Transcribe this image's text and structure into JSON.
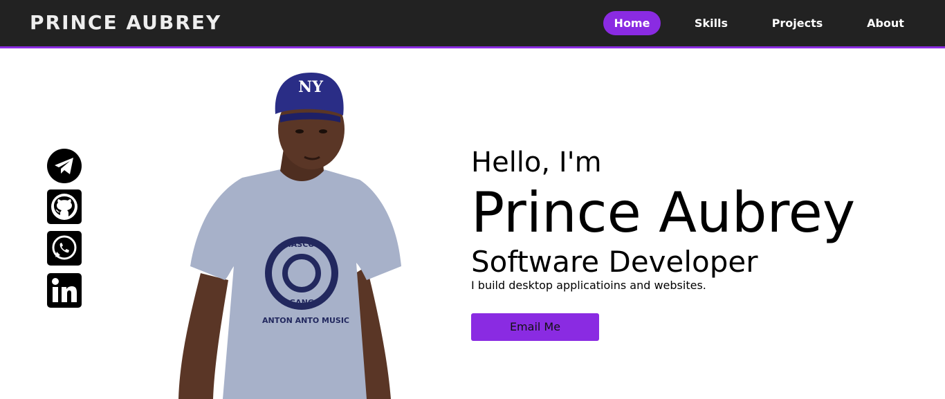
{
  "nav": {
    "brand": "PRINCE AUBREY",
    "links": [
      {
        "label": "Home",
        "active": true
      },
      {
        "label": "Skills",
        "active": false
      },
      {
        "label": "Projects",
        "active": false
      },
      {
        "label": "About",
        "active": false
      }
    ]
  },
  "social": [
    {
      "icon": "telegram-icon"
    },
    {
      "icon": "github-icon"
    },
    {
      "icon": "whatsapp-icon"
    },
    {
      "icon": "linkedin-icon"
    }
  ],
  "hero": {
    "greeting": "Hello, I'm",
    "name": "Prince Aubrey",
    "role": "Software Developer",
    "tagline": "I build desktop applicatioins and websites.",
    "cta_label": "Email Me",
    "photo_logo_lines": [
      "MASCOT",
      "GANG",
      "ANTON ANTO MUSIC"
    ],
    "cap_logo": "NY"
  },
  "colors": {
    "accent": "#8a2be2",
    "navbar": "#222222",
    "background": "#ffffff"
  }
}
